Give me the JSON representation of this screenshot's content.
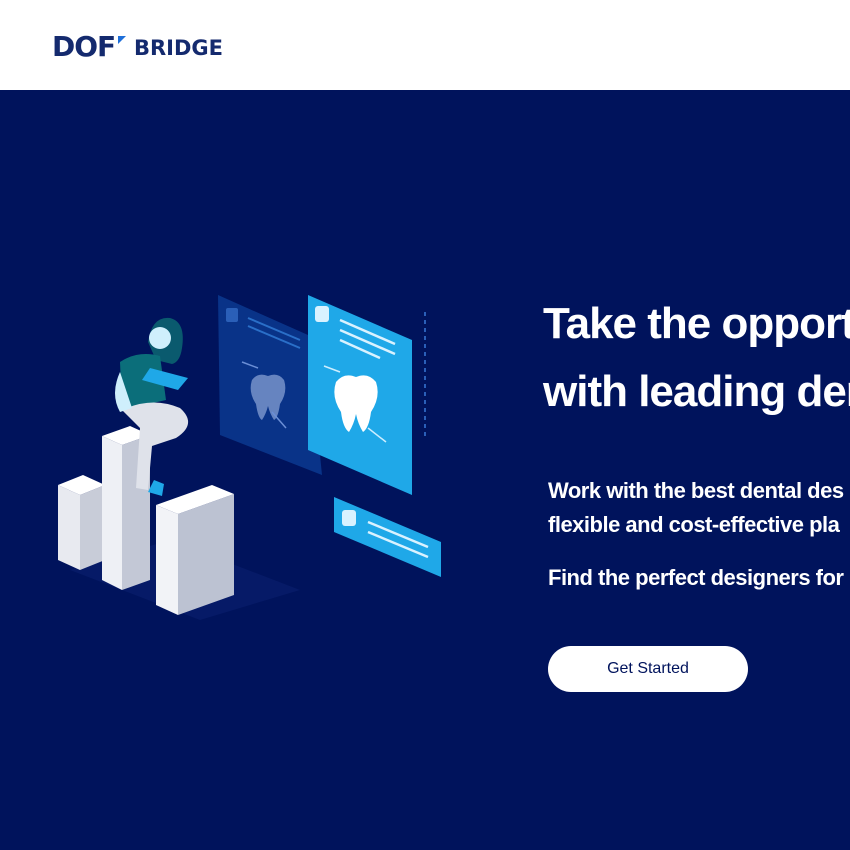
{
  "header": {
    "logo": {
      "mark": "DOF",
      "word": "BRIDGE"
    }
  },
  "hero": {
    "headline_line1": "Take the opportu",
    "headline_line2": "with leading den",
    "desc_line1": "Work with the best dental des",
    "desc_line2": "flexible and cost-effective pla",
    "desc_line3": "Find the perfect designers for",
    "cta_label": "Get Started"
  },
  "colors": {
    "brand_navy": "#00135c",
    "logo_navy": "#142a6e",
    "logo_accent": "#1e6fd9",
    "accent_cyan": "#1fa8e8",
    "white": "#ffffff"
  },
  "icons": [
    "dof-bridge-logo",
    "dental-designer-illustration",
    "tooth-icon"
  ]
}
